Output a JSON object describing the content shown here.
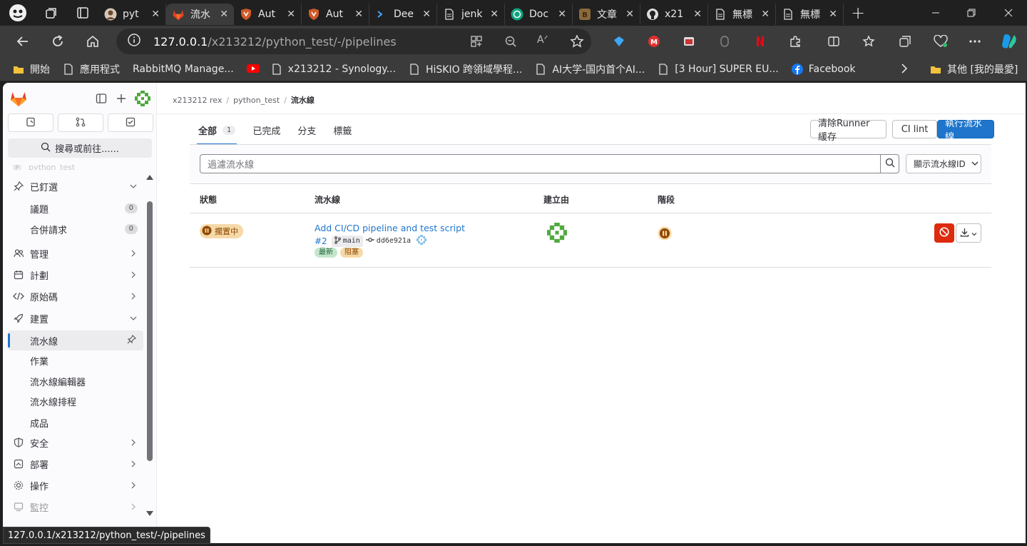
{
  "browser": {
    "tabs": [
      {
        "title": "pyt",
        "favicon": "avatar-icon"
      },
      {
        "title": "流水",
        "favicon": "gitlab-icon",
        "active": true
      },
      {
        "title": "Aut",
        "favicon": "shield-icon"
      },
      {
        "title": "Aut",
        "favicon": "shield-icon"
      },
      {
        "title": "Dee",
        "favicon": "terminal-icon"
      },
      {
        "title": "jenk",
        "favicon": "page-icon"
      },
      {
        "title": "Doc",
        "favicon": "chatgpt-icon"
      },
      {
        "title": "文章",
        "favicon": "b-icon"
      },
      {
        "title": "x21",
        "favicon": "github-icon"
      },
      {
        "title": "無標",
        "favicon": "page-icon"
      },
      {
        "title": "無標",
        "favicon": "page-icon"
      }
    ],
    "url_host": "127.0.0.1",
    "url_path": "/x213212/python_test/-/pipelines",
    "bookmarks": [
      "開始",
      "應用程式",
      "RabbitMQ Manage...",
      "x213212 - Synology...",
      "HiSKIO 跨領域學程...",
      "AI大学-国内首个AI...",
      "[3 Hour] SUPER EU...",
      "Facebook"
    ],
    "bookmark_other": "其他 [我的最愛]",
    "status_url": "127.0.0.1/x213212/python_test/-/pipelines"
  },
  "sidebar": {
    "search_label": "搜尋或前往......",
    "project_faded": "python_test",
    "pinned": {
      "label": "已釘選",
      "items": [
        {
          "label": "議題",
          "count": "0"
        },
        {
          "label": "合併請求",
          "count": "0"
        }
      ]
    },
    "sections": [
      "管理",
      "計劃",
      "原始碼",
      "建置"
    ],
    "build_items": [
      "流水線",
      "作業",
      "流水線編輯器",
      "流水線排程",
      "成品"
    ],
    "sections_after": [
      "安全",
      "部署",
      "操作",
      "監控"
    ]
  },
  "breadcrumb": {
    "user": "x213212 rex",
    "project": "python_test",
    "current": "流水線"
  },
  "tabs": [
    {
      "label": "全部",
      "count": "1"
    },
    {
      "label": "已完成"
    },
    {
      "label": "分支"
    },
    {
      "label": "標籤"
    }
  ],
  "actions": {
    "clear_cache": "清除Runner緩存",
    "ci_lint": "CI lint",
    "run_pipeline": "執行流水線"
  },
  "filter": {
    "placeholder": "過濾流水線",
    "dropdown": "顯示流水線ID"
  },
  "table": {
    "headers": [
      "狀態",
      "流水線",
      "建立由",
      "階段"
    ],
    "rows": [
      {
        "status": "擱置中",
        "title": "Add CI/CD pipeline and test script",
        "id": "#2",
        "ref": "main",
        "sha": "dd6e921a",
        "badges": [
          "最新",
          "阻塞"
        ]
      }
    ]
  },
  "colors": {
    "primary": "#1f75cb",
    "danger": "#dd2b0e",
    "pending_bg": "#f5d9a8",
    "pending_fg": "#8f4700",
    "latest_bg": "#c3e6cd"
  }
}
